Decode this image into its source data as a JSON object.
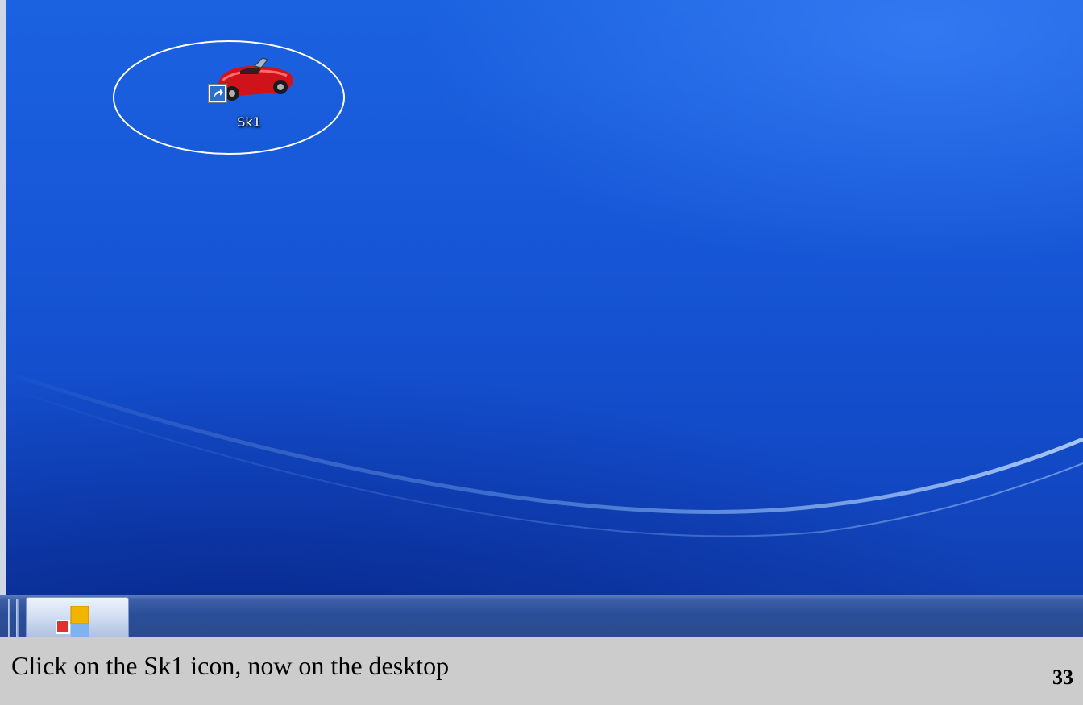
{
  "desktop": {
    "icons": [
      {
        "label": "Sk1",
        "icon": "red-convertible-car-icon",
        "shortcut": true
      }
    ],
    "highlight": {
      "shape": "ellipse",
      "color": "#ffffff"
    },
    "wallpaper": {
      "colors": [
        "#1b62e0",
        "#103ca8"
      ]
    }
  },
  "taskbar": {
    "active_button_icon": "app-window-icon"
  },
  "caption": {
    "text": "Click on the Sk1 icon, now on the desktop",
    "slide_number": "33"
  }
}
